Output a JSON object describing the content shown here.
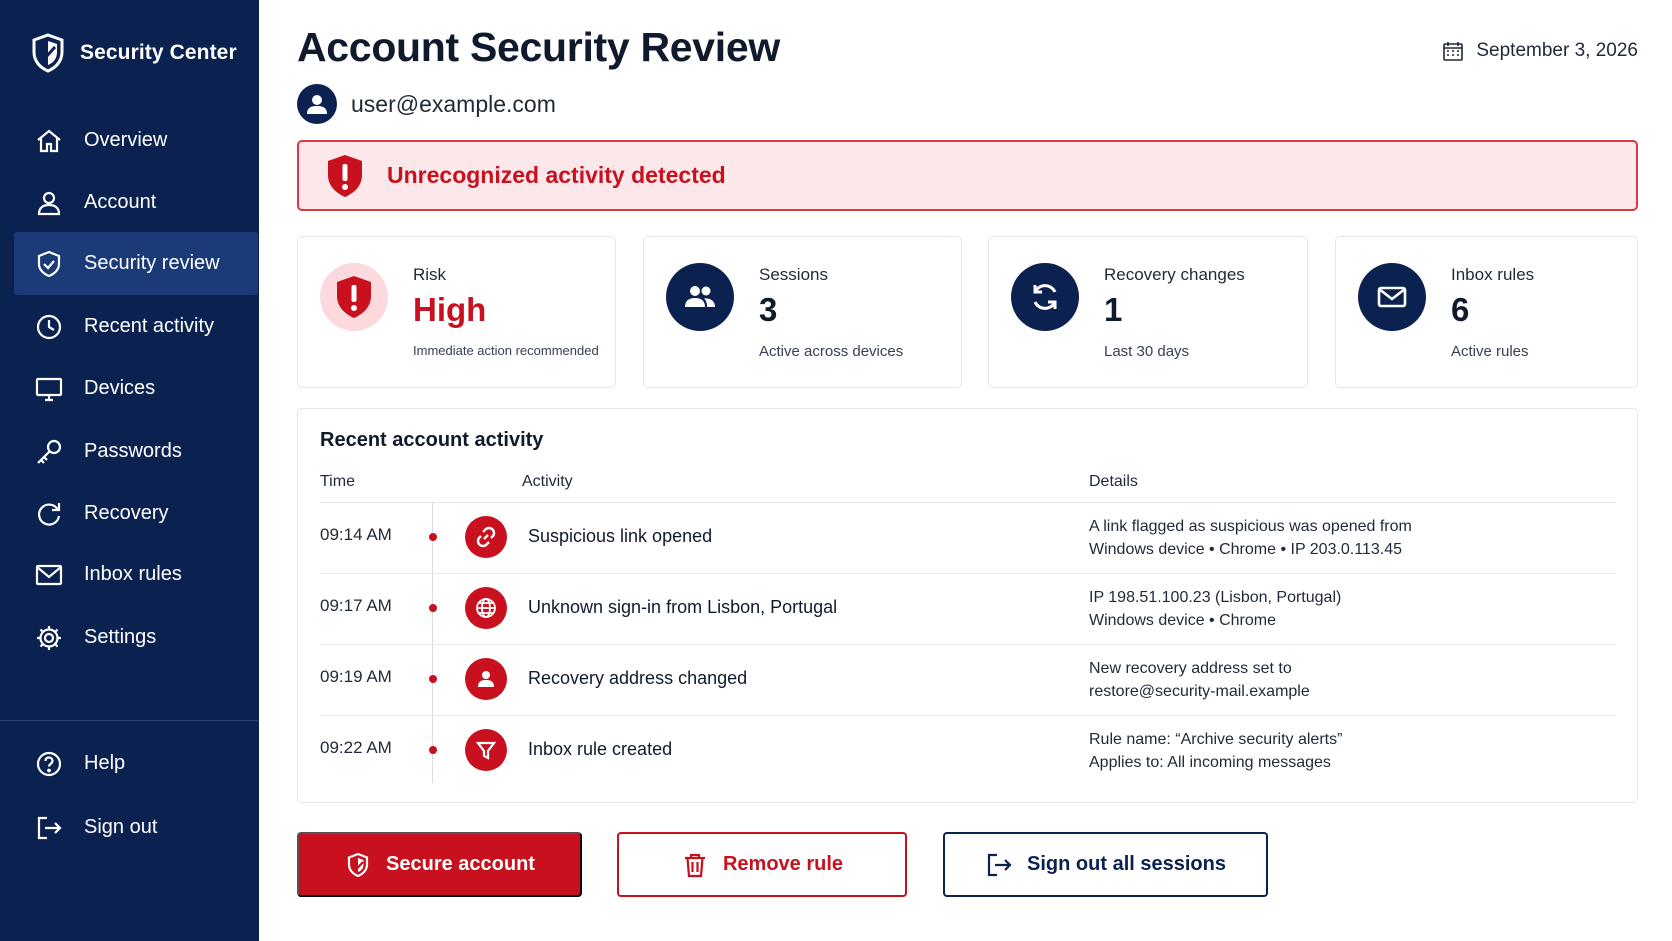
{
  "colors": {
    "sidebar_bg": "#0b2150",
    "sidebar_active": "#1b3a78",
    "danger": "#c8101e",
    "alert_bg": "#fce8ea",
    "navy": "#0b2150"
  },
  "brand": {
    "title": "Security Center",
    "icon": "shield-check-icon"
  },
  "sidebar": {
    "items": [
      {
        "label": "Overview",
        "icon": "home-icon"
      },
      {
        "label": "Account",
        "icon": "user-icon"
      },
      {
        "label": "Security review",
        "icon": "shield-check-icon",
        "active": true
      },
      {
        "label": "Recent activity",
        "icon": "clock-icon"
      },
      {
        "label": "Devices",
        "icon": "monitor-icon"
      },
      {
        "label": "Passwords",
        "icon": "key-icon"
      },
      {
        "label": "Recovery",
        "icon": "refresh-icon"
      },
      {
        "label": "Inbox rules",
        "icon": "mail-icon"
      },
      {
        "label": "Settings",
        "icon": "gear-icon"
      }
    ],
    "footer": [
      {
        "label": "Help",
        "icon": "help-circle-icon"
      },
      {
        "label": "Sign out",
        "icon": "sign-out-icon"
      }
    ]
  },
  "header": {
    "title": "Account Security Review",
    "date": "September 3, 2026",
    "user_email": "user@example.com"
  },
  "alert": {
    "text": "Unrecognized activity detected"
  },
  "stats": [
    {
      "label": "Risk",
      "value": "High",
      "sub": "Immediate action recommended",
      "icon": "shield-alert-icon"
    },
    {
      "label": "Sessions",
      "value": "3",
      "sub": "Active across devices",
      "icon": "users-icon"
    },
    {
      "label": "Recovery changes",
      "value": "1",
      "sub": "Last 30 days",
      "icon": "refresh-icon"
    },
    {
      "label": "Inbox rules",
      "value": "6",
      "sub": "Active rules",
      "icon": "mail-icon"
    }
  ],
  "activity": {
    "title": "Recent account activity",
    "columns": {
      "time": "Time",
      "activity": "Activity",
      "details": "Details"
    },
    "rows": [
      {
        "time": "09:14 AM",
        "activity": "Suspicious link opened",
        "details": [
          "A link flagged as suspicious was opened from",
          "Windows device • Chrome • IP 203.0.113.45"
        ],
        "icon": "link-icon"
      },
      {
        "time": "09:17 AM",
        "activity": "Unknown sign-in from Lisbon, Portugal",
        "details": [
          "IP 198.51.100.23 (Lisbon, Portugal)",
          "Windows device • Chrome"
        ],
        "icon": "globe-icon"
      },
      {
        "time": "09:19 AM",
        "activity": "Recovery address changed",
        "details": [
          "New recovery address set to",
          "restore@security-mail.example"
        ],
        "icon": "user-icon"
      },
      {
        "time": "09:22 AM",
        "activity": "Inbox rule created",
        "details": [
          "Rule name: “Archive security alerts”",
          "Applies to: All incoming messages"
        ],
        "icon": "filter-icon"
      }
    ]
  },
  "actions": {
    "secure": "Secure account",
    "remove_rule": "Remove rule",
    "sign_out_all": "Sign out all sessions"
  }
}
